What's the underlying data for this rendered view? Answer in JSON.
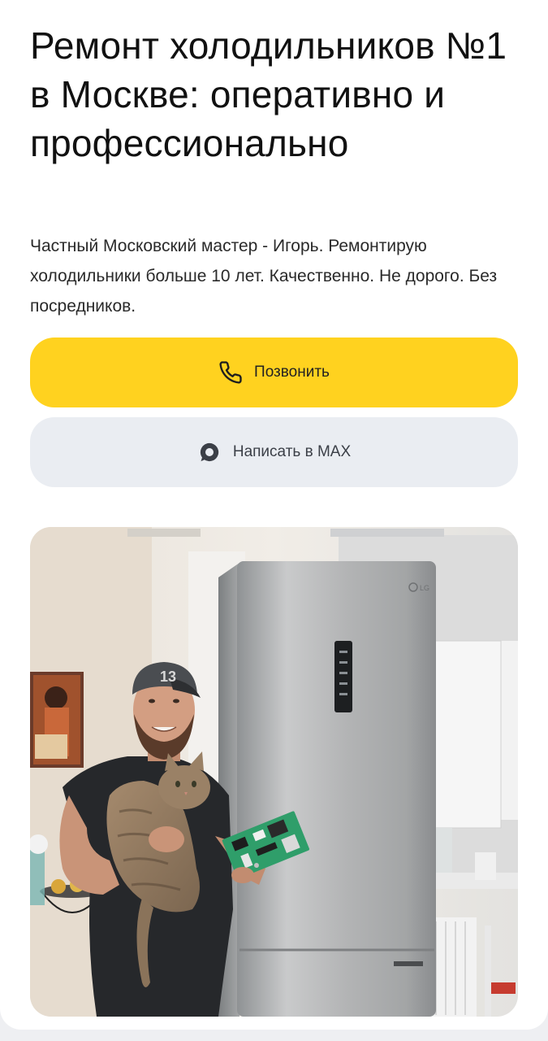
{
  "hero": {
    "title": "Ремонт холодильников №1 в Москве: оперативно и профессионально",
    "subtitle": "Частный Московский мастер - Игорь. Ремонтирую холодильники больше 10 лет. Качественно. Не дорого. Без посредников."
  },
  "buttons": {
    "call": {
      "label": "Позвонить",
      "icon": "phone-icon",
      "color": "#ffd21f"
    },
    "max": {
      "label": "Написать в MAX",
      "icon": "max-messenger-icon",
      "color": "#eaedf2"
    }
  },
  "photo": {
    "alt": "",
    "fridge_brand": "LG",
    "cap_text": "13"
  }
}
